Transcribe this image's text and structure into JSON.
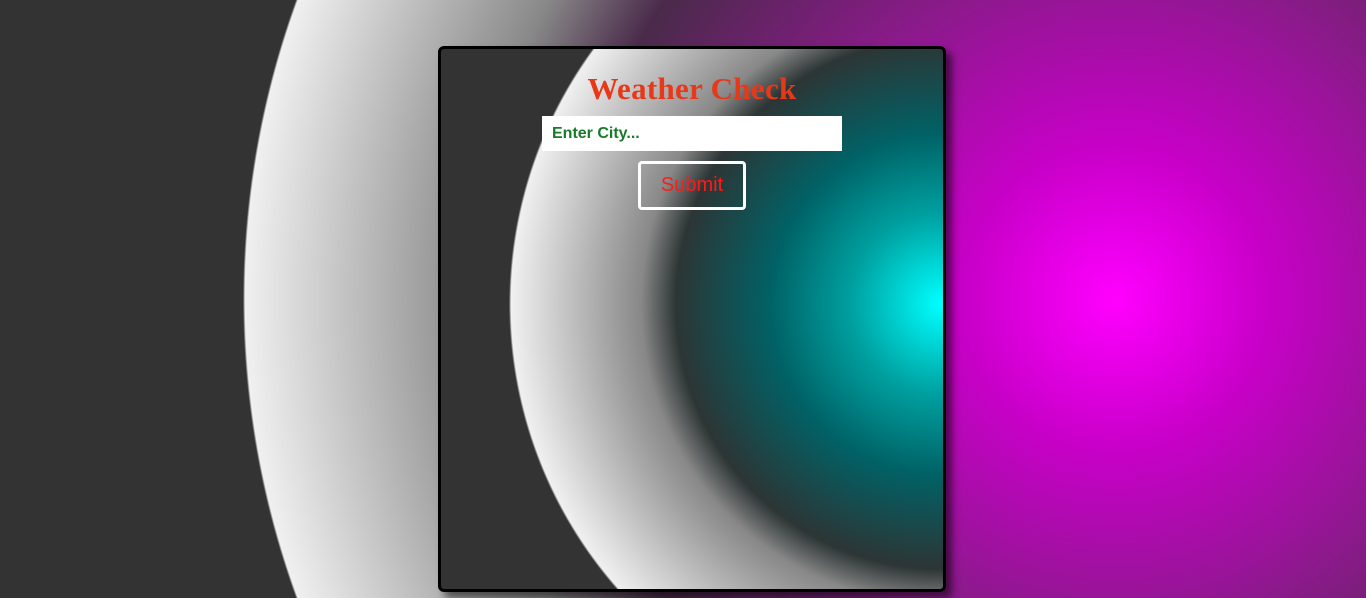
{
  "header": {
    "title": "Weather Check"
  },
  "search": {
    "placeholder": "Enter City...",
    "value": ""
  },
  "actions": {
    "submit_label": "Submit"
  },
  "colors": {
    "title": "#e8381a",
    "input_text": "#1a7a2a",
    "button_text": "#ff1a1a",
    "button_border": "#ffffff",
    "background_glow": "#ff00ff",
    "card_glow": "#00ffff",
    "card_border": "#000000"
  }
}
